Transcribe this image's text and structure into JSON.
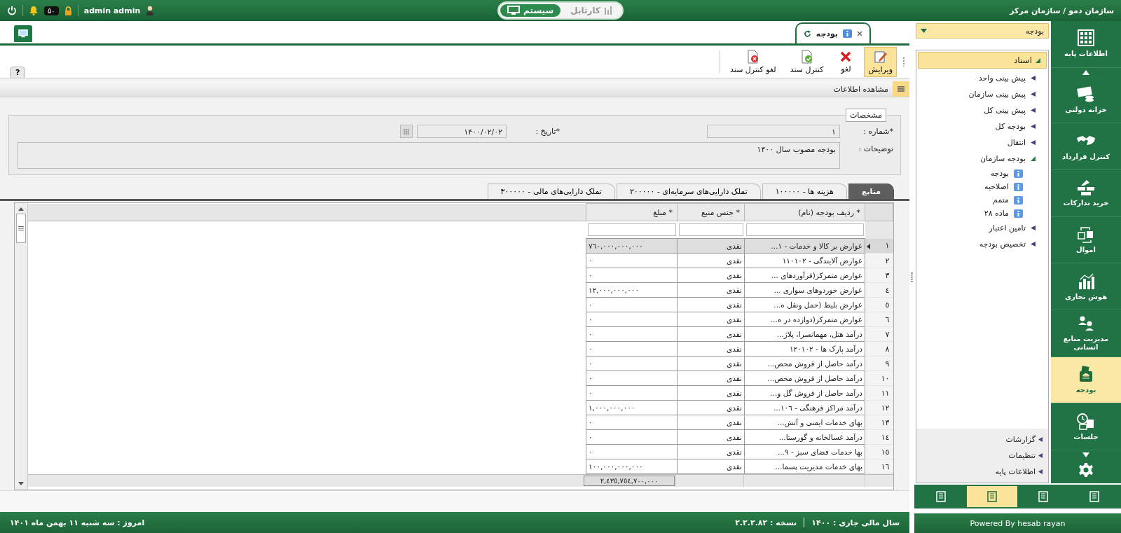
{
  "top_bar": {
    "org_path": "سازمان دمو / سازمان مرکز",
    "mode_tabs": [
      {
        "label": "کارتابل",
        "kind": "cartable",
        "selected": false
      },
      {
        "label": "سیستم",
        "kind": "system",
        "selected": true
      }
    ],
    "user": "admin admin",
    "notification_count": "۵۰"
  },
  "doc_tab": {
    "label": "بودجه"
  },
  "toolbar": [
    {
      "label": "ویرایش",
      "kind": "edit",
      "selected": true
    },
    {
      "label": "لغو",
      "kind": "cancel",
      "selected": false
    },
    {
      "label": "کنترل سند",
      "kind": "check",
      "selected": false
    },
    {
      "label": "لغو کنترل سند",
      "kind": "uncheck",
      "selected": false
    }
  ],
  "help_tab": "?",
  "section_title": "مشاهده اطلاعات",
  "form": {
    "legend": "مشخصات",
    "number": {
      "label": "*شماره :",
      "value": "۱"
    },
    "date": {
      "label": "*تاریخ :",
      "value": "۱۴۰۰/۰۲/۰۲"
    },
    "description": {
      "label": "توضیحات :",
      "value": "بودجه مصوب سال ۱۴۰۰"
    }
  },
  "sub_tabs": [
    {
      "label": "منابع",
      "selected": true
    },
    {
      "label": "هزینه ها - ۱۰۰۰۰۰",
      "selected": false
    },
    {
      "label": "تملک دارایی‌های سرمایه‌ای - ۲۰۰۰۰۰",
      "selected": false
    },
    {
      "label": "تملک دارایی‌های مالی - ۳۰۰۰۰۰",
      "selected": false
    }
  ],
  "grid": {
    "columns": [
      "* ردیف بودجه (نام)",
      "* جنس منبع",
      "* مبلغ"
    ],
    "rows": [
      {
        "number": "۱",
        "name": "عوارض بر کالا و خدمات - ۱...",
        "type": "نقدی",
        "amount": "۷٦۰,۰۰۰,۰۰۰,۰۰۰",
        "selected": true
      },
      {
        "number": "۲",
        "name": "عوارض آلایندگی - ۱۱۰۱۰۲",
        "type": "نقدی",
        "amount": "۰",
        "selected": false
      },
      {
        "number": "۳",
        "name": "عوارض متمرکز(فرآوردهای ...",
        "type": "نقدی",
        "amount": "۰",
        "selected": false
      },
      {
        "number": "٤",
        "name": "عوارض خوردوهای سواری ...",
        "type": "نقدی",
        "amount": "۱۲,۰۰۰,۰۰۰,۰۰۰",
        "selected": false
      },
      {
        "number": "٥",
        "name": "عوارض بلیط (حمل ونقل ه...",
        "type": "نقدی",
        "amount": "۰",
        "selected": false
      },
      {
        "number": "٦",
        "name": "عوارض متمرکز(دوازده در ه...",
        "type": "نقدی",
        "amount": "۰",
        "selected": false
      },
      {
        "number": "۷",
        "name": "درآمد هتل، مهمانسرا، پلاژ...",
        "type": "نقدی",
        "amount": "۰",
        "selected": false
      },
      {
        "number": "۸",
        "name": "درآمد پارک ها - ۱۲۰۱۰۲",
        "type": "نقدی",
        "amount": "۰",
        "selected": false
      },
      {
        "number": "۹",
        "name": "درآمد حاصل از فروش محص...",
        "type": "نقدی",
        "amount": "۰",
        "selected": false
      },
      {
        "number": "۱۰",
        "name": "درآمد حاصل از فروش محص...",
        "type": "نقدی",
        "amount": "۰",
        "selected": false
      },
      {
        "number": "۱۱",
        "name": "درآمد حاصل از فروش گل و...",
        "type": "نقدی",
        "amount": "۰",
        "selected": false
      },
      {
        "number": "۱۲",
        "name": "درآمد مراکز فرهنگی - ۱۰٦...",
        "type": "نقدی",
        "amount": "۱,۰۰۰,۰۰۰,۰۰۰",
        "selected": false
      },
      {
        "number": "۱۳",
        "name": "بهای خدمات ایمنی و آتش...",
        "type": "نقدی",
        "amount": "۰",
        "selected": false
      },
      {
        "number": "۱٤",
        "name": "درآمد غسالخانه و گورستا...",
        "type": "نقدی",
        "amount": "۰",
        "selected": false
      },
      {
        "number": "۱٥",
        "name": "بها خدمات فضای سبز - ۹...",
        "type": "نقدی",
        "amount": "۰",
        "selected": false
      },
      {
        "number": "۱٦",
        "name": "بهای خدمات مدیریت پسما...",
        "type": "نقدی",
        "amount": "۱۰۰,۰۰۰,۰۰۰,۰۰۰",
        "selected": false
      }
    ],
    "total": "۲,٤۳٥,۷٥٤,۷۰۰,۰۰۰"
  },
  "sidebar": {
    "module": "بودجه",
    "tree": {
      "label": "اسناد",
      "expanded": true,
      "children": [
        {
          "label": "پیش بینی واحد",
          "expanded": false
        },
        {
          "label": "پیش بینی سازمان",
          "expanded": false
        },
        {
          "label": "پیش بینی کل",
          "expanded": false
        },
        {
          "label": "بودجه کل",
          "expanded": false
        },
        {
          "label": "انتقال",
          "expanded": false
        },
        {
          "label": "بودجه سازمان",
          "expanded": true,
          "children": [
            {
              "label": "بودجه"
            },
            {
              "label": "اصلاحیه"
            },
            {
              "label": "متمم"
            },
            {
              "label": "ماده ۲۸"
            }
          ]
        },
        {
          "label": "تامین اعتبار",
          "expanded": false
        },
        {
          "label": "تخصیص بودجه",
          "expanded": false
        }
      ]
    },
    "groups": [
      {
        "label": "گزارشات",
        "expanded": false
      },
      {
        "label": "تنظیمات",
        "expanded": false
      },
      {
        "label": "اطلاعات پایه",
        "expanded": false
      }
    ]
  },
  "rail": [
    {
      "label": "اطلاعات پایه",
      "kind": "grid",
      "selected": false
    },
    {
      "label": "خزانه دولتی",
      "kind": "treasury",
      "selected": false
    },
    {
      "label": "کنترل قرارداد",
      "kind": "handshake",
      "selected": false
    },
    {
      "label": "خرید تدارکات",
      "kind": "bricks",
      "selected": false
    },
    {
      "label": "اموال",
      "kind": "assets",
      "selected": false
    },
    {
      "label": "هوش تجاری",
      "kind": "chart",
      "selected": false
    },
    {
      "label": "مدیریت منابع انسانی",
      "kind": "people",
      "selected": false
    },
    {
      "label": "بودجه",
      "kind": "budget",
      "selected": true
    },
    {
      "label": "جلسات",
      "kind": "meeting",
      "selected": false
    }
  ],
  "view_buttons": [
    {
      "selected": false
    },
    {
      "selected": false
    },
    {
      "selected": true
    },
    {
      "selected": false
    }
  ],
  "status_bar": {
    "fiscal_year": "سال مالی جاری : ۱۴۰۰",
    "version": "نسخه : ۲.۲.۲.۸۲",
    "today": "امروز : سه شنبه ۱۱ بهمن ماه ۱۴۰۱",
    "powered": "Powered By hesab rayan"
  }
}
